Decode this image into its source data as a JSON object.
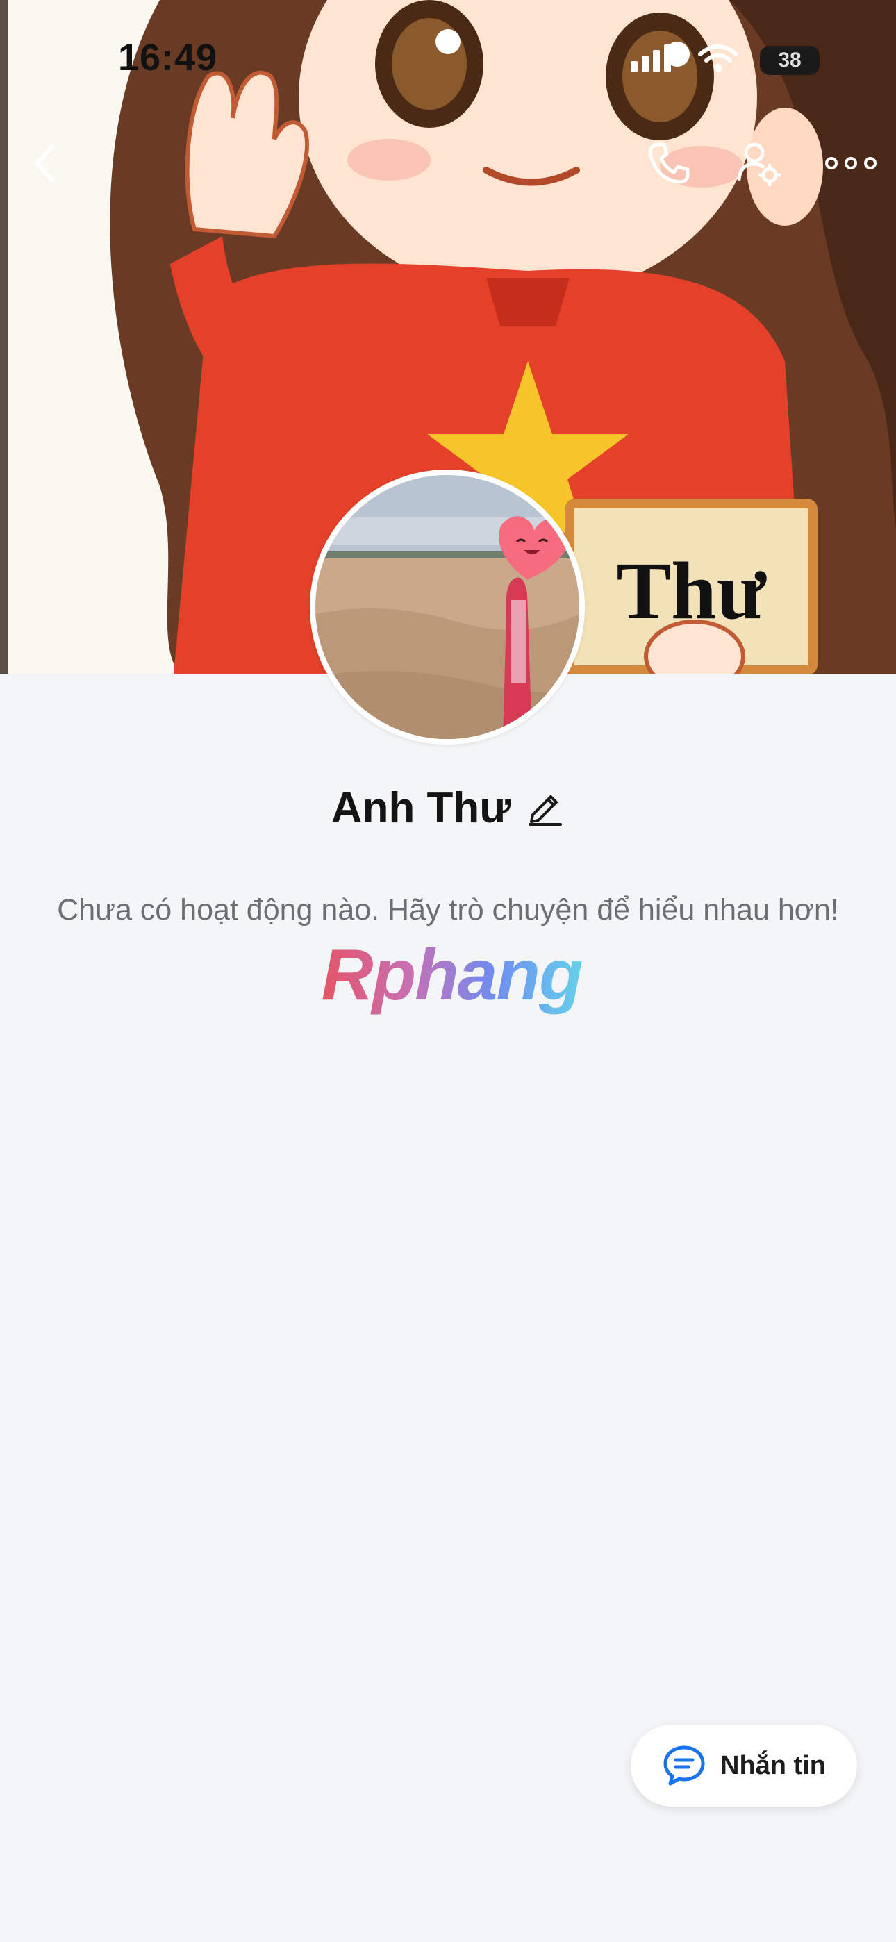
{
  "status_bar": {
    "time": "16:49",
    "battery_level": "38",
    "icons": [
      "signal-icon",
      "wifi-icon",
      "battery-icon"
    ]
  },
  "nav": {
    "icons": [
      "back-icon",
      "phone-icon",
      "user-settings-icon",
      "more-icon"
    ]
  },
  "cover": {
    "sign_text": "Thư"
  },
  "profile": {
    "name": "Anh Thư",
    "empty_message": "Chưa có hoạt động nào. Hãy trò chuyện để hiểu nhau hơn!"
  },
  "watermark": "Rphang",
  "actions": {
    "message_label": "Nhắn tin"
  },
  "colors": {
    "accent": "#1a73e8",
    "background": "#f4f5f7"
  }
}
